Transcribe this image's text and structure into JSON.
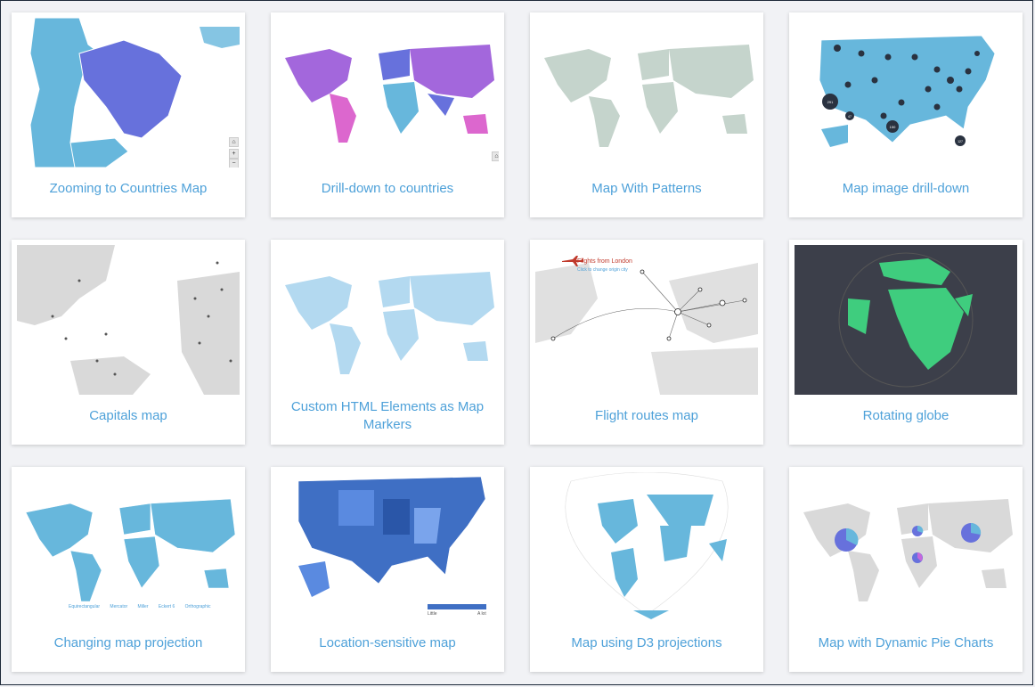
{
  "cards": [
    {
      "title": "Zooming to Countries Map",
      "icon": "map-zoom-countries"
    },
    {
      "title": "Drill-down to countries",
      "icon": "map-drilldown"
    },
    {
      "title": "Map With Patterns",
      "icon": "map-patterns"
    },
    {
      "title": "Map image drill-down",
      "icon": "map-image-drilldown"
    },
    {
      "title": "Capitals map",
      "icon": "map-capitals"
    },
    {
      "title": "Custom HTML Elements as Map Markers",
      "icon": "map-html-markers"
    },
    {
      "title": "Flight routes map",
      "icon": "map-flight-routes"
    },
    {
      "title": "Rotating globe",
      "icon": "globe"
    },
    {
      "title": "Changing map projection",
      "icon": "map-projection"
    },
    {
      "title": "Location-sensitive map",
      "icon": "map-us-choropleth"
    },
    {
      "title": "Map using D3 projections",
      "icon": "map-d3"
    },
    {
      "title": "Map with Dynamic Pie Charts",
      "icon": "map-pie"
    }
  ],
  "flight": {
    "title": "Flights from London",
    "subtitle": "Click to change origin city"
  },
  "legend": {
    "low": "Little",
    "high": "A lot"
  },
  "projections": [
    "Equirectangular",
    "Mercator",
    "Miller",
    "Eckert 6",
    "Orthographic"
  ],
  "cluster_counts": [
    "291",
    "150",
    "127",
    "47"
  ],
  "colors": {
    "accent": "#4ea1d9",
    "map_blue": "#67b7dc",
    "map_purple": "#6771dc",
    "map_pink": "#dc67ce",
    "globe_green": "#3fcd7e",
    "globe_bg": "#3c3f4a",
    "pattern_gray": "#c5d4cc",
    "land_gray": "#d9d9d9"
  }
}
